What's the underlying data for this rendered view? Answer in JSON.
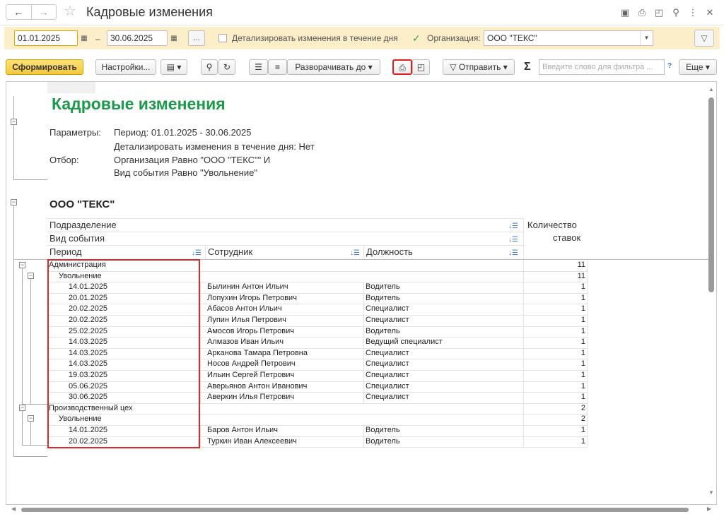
{
  "window": {
    "title": "Кадровые изменения"
  },
  "filters": {
    "date_from": "01.01.2025",
    "date_to": "30.06.2025",
    "dash": "–",
    "ellipsis": "...",
    "detail_label": "Детализировать изменения в течение дня",
    "org_label": "Организация:",
    "org_value": "ООО \"ТЕКС\""
  },
  "toolbar": {
    "generate": "Сформировать",
    "settings": "Настройки...",
    "expand": "Разворачивать до",
    "send": "Отправить",
    "sigma": "Σ",
    "search_placeholder": "Введите слово для фильтра ...",
    "help": "?",
    "more": "Еще"
  },
  "report": {
    "title": "Кадровые изменения",
    "params_label": "Параметры:",
    "params_line1": "Период: 01.01.2025 - 30.06.2025",
    "params_line2": "Детализировать изменения в течение дня: Нет",
    "filter_label": "Отбор:",
    "filter_line1": "Организация Равно \"ООО \"ТЕКС\"\" И",
    "filter_line2": "Вид события Равно \"Увольнение\"",
    "org": "ООО \"ТЕКС\"",
    "headers": {
      "dept": "Подразделение",
      "event": "Вид события",
      "period": "Период",
      "employee": "Сотрудник",
      "position": "Должность",
      "count1": "Количество",
      "count2": "ставок"
    },
    "groups": [
      {
        "dept": "Администрация",
        "dept_count": "11",
        "event": "Увольнение",
        "event_count": "11",
        "rows": [
          {
            "date": "14.01.2025",
            "employee": "Былинин Антон Ильич",
            "position": "Водитель",
            "count": "1"
          },
          {
            "date": "20.01.2025",
            "employee": "Лопухин Игорь Петрович",
            "position": "Водитель",
            "count": "1"
          },
          {
            "date": "20.02.2025",
            "employee": "Абасов Антон Ильич",
            "position": "Специалист",
            "count": "1"
          },
          {
            "date": "20.02.2025",
            "employee": "Лупин Илья Петрович",
            "position": "Специалист",
            "count": "1"
          },
          {
            "date": "25.02.2025",
            "employee": "Амосов Игорь Петрович",
            "position": "Водитель",
            "count": "1"
          },
          {
            "date": "14.03.2025",
            "employee": "Алмазов Иван Ильич",
            "position": "Ведущий специалист",
            "count": "1"
          },
          {
            "date": "14.03.2025",
            "employee": "Арканова Тамара Петровна",
            "position": "Специалист",
            "count": "1"
          },
          {
            "date": "14.03.2025",
            "employee": "Носов Андрей Петрович",
            "position": "Специалист",
            "count": "1"
          },
          {
            "date": "19.03.2025",
            "employee": "Ильин Сергей Петрович",
            "position": "Специалист",
            "count": "1"
          },
          {
            "date": "05.06.2025",
            "employee": "Аверьянов Антон Иванович",
            "position": "Специалист",
            "count": "1"
          },
          {
            "date": "30.06.2025",
            "employee": "Аверкин Илья Петрович",
            "position": "Специалист",
            "count": "1"
          }
        ]
      },
      {
        "dept": "Производственный цех",
        "dept_count": "2",
        "event": "Увольнение",
        "event_count": "2",
        "rows": [
          {
            "date": "14.01.2025",
            "employee": "Баров Антон Ильич",
            "position": "Водитель",
            "count": "1"
          },
          {
            "date": "20.02.2025",
            "employee": "Туркин Иван Алексеевич",
            "position": "Водитель",
            "count": "1"
          }
        ]
      }
    ]
  }
}
